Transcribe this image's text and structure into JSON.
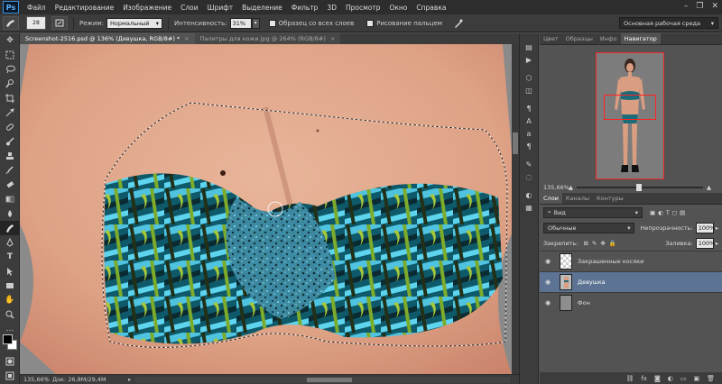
{
  "app": {
    "logo": "Ps"
  },
  "menu": [
    "Файл",
    "Редактирование",
    "Изображение",
    "Слои",
    "Шрифт",
    "Выделение",
    "Фильтр",
    "3D",
    "Просмотр",
    "Окно",
    "Справка"
  ],
  "window_controls": {
    "minimize": "–",
    "restore": "❐",
    "close": "✕"
  },
  "options": {
    "brush_size": "28",
    "mode_label": "Режим:",
    "mode_value": "Нормальный",
    "strength_label": "Интенсивность:",
    "strength_value": "31%",
    "sample_all_label": "Образец со всех слоев",
    "finger_paint_label": "Рисование пальцем",
    "workspace": "Основная рабочая среда"
  },
  "document_tabs": [
    {
      "label": "Screenshot-2516.psd @ 136% (Девушка, RGB/8#) *",
      "close": "×"
    },
    {
      "label": "Палитры для кожи.jpg @ 264% (RGB/8#)",
      "close": "×"
    }
  ],
  "status": {
    "zoom": "135,66%",
    "doc": "Док: 26,8M/29,4M"
  },
  "panel_tabs_top": [
    "Цвет",
    "Образцы",
    "Инфо",
    "Навигатор"
  ],
  "navigator": {
    "zoom": "135,66%"
  },
  "panel_tabs_layers": [
    "Слои",
    "Каналы",
    "Контуры"
  ],
  "layers_panel": {
    "kind_filter": "Вид",
    "blend_mode": "Обычные",
    "opacity_label": "Непрозрачность:",
    "opacity_value": "100%",
    "lock_label": "Закрепить:",
    "fill_label": "Заливка:",
    "fill_value": "100%",
    "layers": [
      {
        "name": "Закрашенные косяки",
        "selected": false
      },
      {
        "name": "Девушка",
        "selected": true
      },
      {
        "name": "Фон",
        "selected": false
      }
    ]
  },
  "colors": {
    "accent": "#5d7393",
    "foreground": "#000000",
    "background": "#ffffff"
  }
}
